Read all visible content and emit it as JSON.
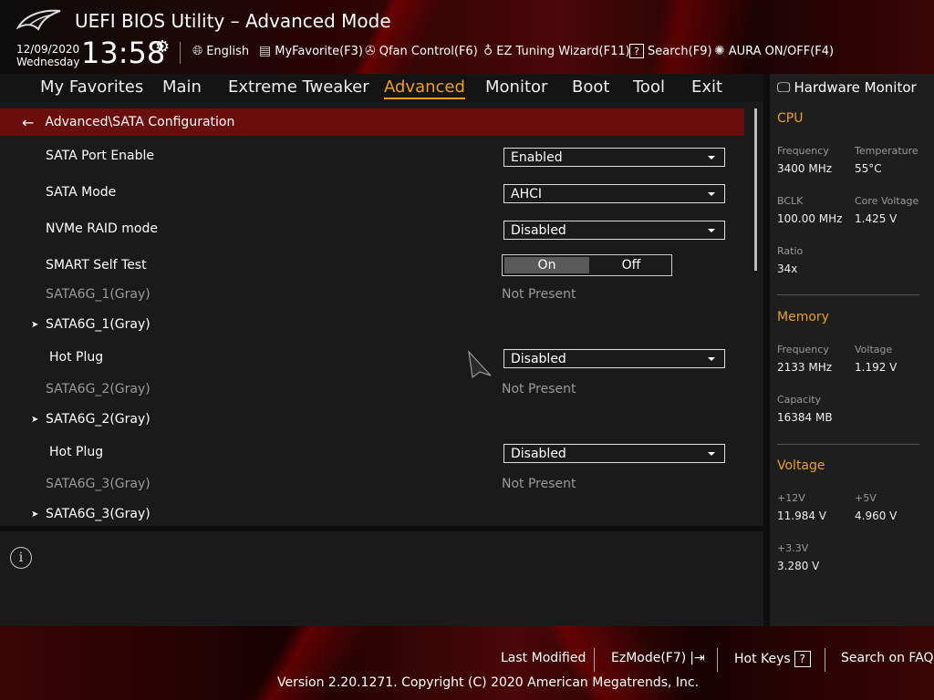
{
  "header": {
    "title": "UEFI BIOS Utility – Advanced Mode",
    "date": "12/09/2020",
    "weekday": "Wednesday",
    "time": "13:58",
    "toolbar": [
      {
        "label": "English",
        "icon": "globe-icon"
      },
      {
        "label": "MyFavorite(F3)",
        "icon": "keyboard-icon"
      },
      {
        "label": "Qfan Control(F6)",
        "icon": "fan-icon"
      },
      {
        "label": "EZ Tuning Wizard(F11)",
        "icon": "lightbulb-icon"
      },
      {
        "label": "Search(F9)",
        "icon": "question-box-icon"
      },
      {
        "label": "AURA ON/OFF(F4)",
        "icon": "aura-icon"
      }
    ]
  },
  "nav": {
    "tabs": [
      "My Favorites",
      "Main",
      "Extreme Tweaker",
      "Advanced",
      "Monitor",
      "Boot",
      "Tool",
      "Exit"
    ],
    "active": "Advanced"
  },
  "breadcrumb": "Advanced\\SATA Configuration",
  "settings": {
    "sata_port_enable": {
      "label": "SATA Port Enable",
      "value": "Enabled"
    },
    "sata_mode": {
      "label": "SATA Mode",
      "value": "AHCI"
    },
    "nvme_raid": {
      "label": "NVMe RAID mode",
      "value": "Disabled"
    },
    "smart": {
      "label": "SMART Self Test",
      "on": "On",
      "off": "Off",
      "selected": "On"
    },
    "port1_status": {
      "label": "SATA6G_1(Gray)",
      "value": "Not Present"
    },
    "port1_sub": {
      "label": "SATA6G_1(Gray)"
    },
    "port1_hotplug": {
      "label": "Hot Plug",
      "value": "Disabled"
    },
    "port2_status": {
      "label": "SATA6G_2(Gray)",
      "value": "Not Present"
    },
    "port2_sub": {
      "label": "SATA6G_2(Gray)"
    },
    "port2_hotplug": {
      "label": "Hot Plug",
      "value": "Disabled"
    },
    "port3_status": {
      "label": "SATA6G_3(Gray)",
      "value": "Not Present"
    },
    "port3_sub": {
      "label": "SATA6G_3(Gray)"
    }
  },
  "hardware_monitor": {
    "title": "Hardware Monitor",
    "cpu": {
      "heading": "CPU",
      "frequency_label": "Frequency",
      "frequency": "3400 MHz",
      "temperature_label": "Temperature",
      "temperature": "55°C",
      "bclk_label": "BCLK",
      "bclk": "100.00 MHz",
      "core_voltage_label": "Core Voltage",
      "core_voltage": "1.425 V",
      "ratio_label": "Ratio",
      "ratio": "34x"
    },
    "memory": {
      "heading": "Memory",
      "frequency_label": "Frequency",
      "frequency": "2133 MHz",
      "voltage_label": "Voltage",
      "voltage": "1.192 V",
      "capacity_label": "Capacity",
      "capacity": "16384 MB"
    },
    "voltage": {
      "heading": "Voltage",
      "v12_label": "+12V",
      "v12": "11.984 V",
      "v5_label": "+5V",
      "v5": "4.960 V",
      "v33_label": "+3.3V",
      "v33": "3.280 V"
    }
  },
  "footer": {
    "last_modified": "Last Modified",
    "ezmode": "EzMode(F7)",
    "hot_keys": "Hot Keys",
    "search_faq": "Search on FAQ",
    "copyright": "Version 2.20.1271. Copyright (C) 2020 American Megatrends, Inc."
  },
  "colors": {
    "accent": "#f0a020",
    "breadcrumb_bg": "#6a0d0d",
    "section_heading": "#e8a02a"
  }
}
